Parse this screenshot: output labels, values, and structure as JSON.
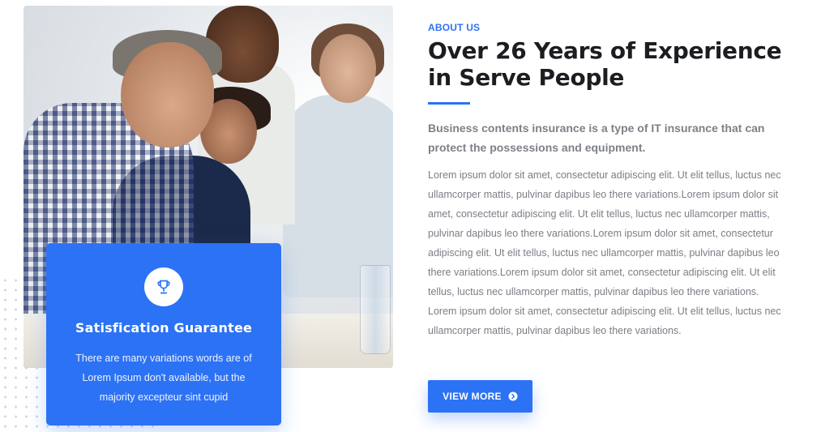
{
  "about": {
    "label": "ABOUT US",
    "headline": "Over 26 Years of Experience in Serve People",
    "lead": "Business contents insurance is a type of IT insurance that can protect the possessions and equipment.",
    "body": "Lorem ipsum dolor sit amet, consectetur adipiscing elit. Ut elit tellus, luctus nec ullamcorper mattis, pulvinar dapibus leo there variations.Lorem ipsum dolor sit amet, consectetur adipiscing elit. Ut elit tellus, luctus nec ullamcorper mattis, pulvinar dapibus leo there variations.Lorem ipsum dolor sit amet, consectetur adipiscing elit. Ut elit tellus, luctus nec ullamcorper mattis, pulvinar dapibus leo there variations.Lorem ipsum dolor sit amet, consectetur adipiscing elit. Ut elit tellus, luctus nec ullamcorper mattis, pulvinar dapibus leo there variations. Lorem ipsum dolor sit amet, consectetur adipiscing elit. Ut elit tellus, luctus nec ullamcorper mattis, pulvinar dapibus leo there variations.",
    "button_label": "VIEW MORE",
    "button_icon": "arrow-circle-right-icon"
  },
  "guarantee": {
    "title": "Satisfication Guarantee",
    "description": "There are many variations words are of Lorem Ipsum don't available, but the majority excepteur sint cupid",
    "icon": "trophy-icon"
  },
  "colors": {
    "accent": "#2c72f4",
    "heading": "#1b1d21",
    "text": "#7a7e85"
  }
}
